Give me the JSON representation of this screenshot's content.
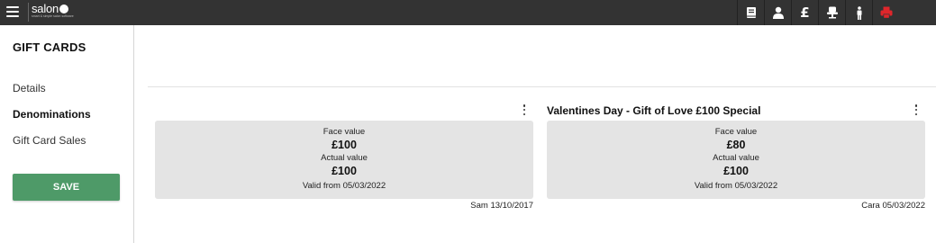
{
  "topbar": {
    "logo_text": "salon",
    "logo_tagline": "smart & simple salon software",
    "icons": [
      "book-icon",
      "user-icon",
      "pound-icon",
      "chair-icon",
      "person-icon",
      "printer-icon"
    ],
    "pound_symbol": "£",
    "printer_color": "#e0262b"
  },
  "sidebar": {
    "title": "GIFT CARDS",
    "items": [
      {
        "label": "Details"
      },
      {
        "label": "Denominations"
      },
      {
        "label": "Gift Card Sales"
      }
    ],
    "save_label": "SAVE",
    "save_color": "#4e9a68"
  },
  "cards": [
    {
      "title": "",
      "face_label": "Face value",
      "face_value": "£100",
      "actual_label": "Actual value",
      "actual_value": "£100",
      "valid": "Valid from 05/03/2022",
      "footer": "Sam 13/10/2017"
    },
    {
      "title": "Valentines Day - Gift of Love £100 Special",
      "face_label": "Face value",
      "face_value": "£80",
      "actual_label": "Actual value",
      "actual_value": "£100",
      "valid": "Valid from 05/03/2022",
      "footer": "Cara 05/03/2022"
    }
  ]
}
